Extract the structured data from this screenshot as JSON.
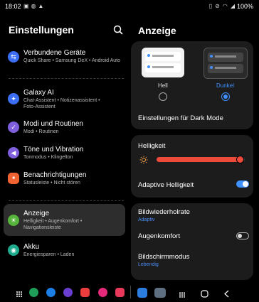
{
  "status": {
    "time": "18:02",
    "battery": "100%"
  },
  "left": {
    "title": "Einstellungen",
    "items": [
      {
        "title": "Verbundene Geräte",
        "sub": "Quick Share • Samsung DeX • Android Auto",
        "color": "#3b6ef5",
        "glyph": "⇆"
      },
      {
        "title": "Galaxy AI",
        "sub": "Chat-Assistent • Notizenassistent •",
        "sub2": "Foto-Assistent",
        "color": "#3b6ef5",
        "glyph": "✦"
      },
      {
        "title": "Modi und Routinen",
        "sub": "Modi • Routinen",
        "color": "#7f5fdc",
        "glyph": "✓"
      },
      {
        "title": "Töne und Vibration",
        "sub": "Tonmodus • Klingelton",
        "color": "#7f5fdc",
        "glyph": "◀"
      },
      {
        "title": "Benachrichtigungen",
        "sub": "Statusleiste • Nicht stören",
        "color": "#f06332",
        "glyph": "■"
      },
      {
        "title": "Anzeige",
        "sub": "Helligkeit • Augenkomfort •",
        "sub2": "Navigationsleiste",
        "color": "#56b43c",
        "glyph": "☀"
      },
      {
        "title": "Akku",
        "sub": "Energiesparen • Laden",
        "color": "#1eaa8c",
        "glyph": "◉"
      }
    ]
  },
  "right": {
    "title": "Anzeige",
    "theme_light": "Hell",
    "theme_dark": "Dunkel",
    "dark_settings": "Einstellungen für Dark Mode",
    "brightness_label": "Helligkeit",
    "brightness_level": 0.95,
    "adaptive_label": "Adaptive Helligkeit",
    "adaptive_on": true,
    "refresh_label": "Bildwiederholrate",
    "refresh_value": "Adaptiv",
    "eye_label": "Augenkomfort",
    "eye_on": false,
    "screen_mode_label": "Bildschirmmodus",
    "screen_mode_value": "Lebendig"
  },
  "colors": {
    "accent": "#3e91ff",
    "slider": "#ec4b3c"
  }
}
